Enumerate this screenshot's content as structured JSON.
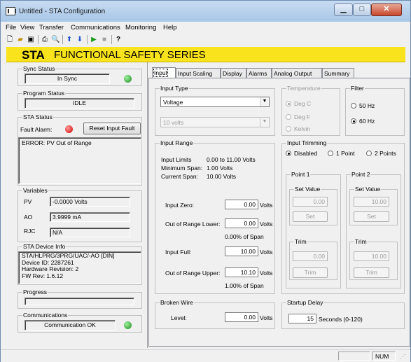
{
  "window": {
    "title": "Untitled - STA Configuration",
    "minimize": "▁",
    "maximize": "□",
    "close": "✕"
  },
  "menu": [
    "File",
    "View",
    "Transfer",
    "Communications",
    "Monitoring",
    "Help"
  ],
  "toolbar_icons": [
    "new-file-icon",
    "open-folder-icon",
    "save-disk-icon",
    "print-icon",
    "print-preview-icon",
    "upload-arrow-icon",
    "download-arrow-icon",
    "play-icon",
    "stop-icon",
    "help-icon"
  ],
  "banner": {
    "bold": "STA",
    "rest": "FUNCTIONAL SAFETY SERIES",
    "color": "#f9e31c"
  },
  "sync": {
    "label": "Sync Status",
    "value": "In Sync"
  },
  "program": {
    "label": "Program Status",
    "value": "IDLE"
  },
  "sta_status": {
    "label": "STA Status",
    "fault_label": "Fault Alarm:",
    "reset_button": "Reset Input Fault",
    "message": "ERROR: PV Out of Range"
  },
  "variables": {
    "label": "Variables",
    "rows": [
      {
        "name": "PV",
        "value": "-0.0000 Volts"
      },
      {
        "name": "AO",
        "value": "3.9999 mA"
      },
      {
        "name": "RJC",
        "value": "N/A"
      }
    ]
  },
  "device_info": {
    "label": "STA Device Info",
    "lines": [
      "STA/HLPRG/3PRG/UAC/-AO [DIN]",
      "Device ID: 2287261",
      "Hardware Revision: 2",
      "FW Rev: 1.6.12"
    ]
  },
  "progress": {
    "label": "Progress"
  },
  "communications": {
    "label": "Communications",
    "value": "Communication OK"
  },
  "tabs": [
    "Input",
    "Input Scaling",
    "Display",
    "Alarms",
    "Analog Output",
    "Summary"
  ],
  "input_type": {
    "label": "Input Type",
    "value": "Voltage",
    "range_value": "10 volts"
  },
  "temperature": {
    "label": "Temperature",
    "options": [
      "Deg C",
      "Deg F",
      "Kelvin"
    ]
  },
  "filter": {
    "label": "Filter",
    "options": [
      "50 Hz",
      "60 Hz"
    ]
  },
  "input_range": {
    "label": "Input Range",
    "limits_label": "Input Limits",
    "limits_value": "0.00 to 11.00 Volts",
    "min_span_label": "Minimum Span:",
    "min_span_value": "1.00 Volts",
    "cur_span_label": "Current Span:",
    "cur_span_value": "10.00 Volts",
    "zero_label": "Input Zero:",
    "zero_value": "0.00",
    "zero_unit": "Volts",
    "oor_lower_label": "Out of Range Lower:",
    "oor_lower_value": "0.00",
    "oor_lower_unit": "Volts",
    "oor_lower_pct": "0.00% of Span",
    "full_label": "Input Full:",
    "full_value": "10.00",
    "full_unit": "Volts",
    "oor_upper_label": "Out of Range Upper:",
    "oor_upper_value": "10.10",
    "oor_upper_unit": "Volts",
    "oor_upper_pct": "1.00% of Span"
  },
  "trimming": {
    "label": "Input Trimming",
    "options": [
      "Disabled",
      "1 Point",
      "2 Points"
    ],
    "point1": {
      "label": "Point 1",
      "set_label": "Set Value",
      "set_value": "0.00",
      "set_button": "Set",
      "trim_label": "Trim",
      "trim_value": "0.00",
      "trim_button": "Trim"
    },
    "point2": {
      "label": "Point 2",
      "set_label": "Set Value",
      "set_value": "10.00",
      "set_button": "Set",
      "trim_label": "Trim",
      "trim_value": "10.00",
      "trim_button": "Trim"
    }
  },
  "broken_wire": {
    "label": "Broken Wire",
    "level_label": "Level:",
    "value": "0.00",
    "unit": "Volts"
  },
  "startup": {
    "label": "Startup Delay",
    "value": "15",
    "unit": "Seconds (0-120)"
  },
  "statusbar": {
    "num": "NUM"
  }
}
